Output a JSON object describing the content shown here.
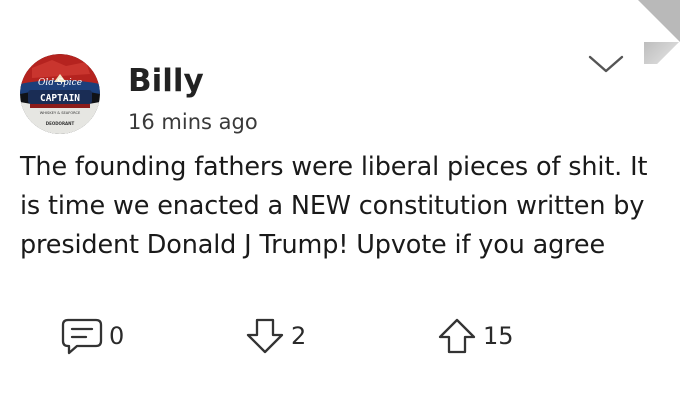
{
  "post": {
    "author": {
      "name": "Billy",
      "avatar": {
        "brand_line1": "Old Spice",
        "brand_line2": "CAPTAIN",
        "brand_line3": "WHISKEY & SEAFORCE",
        "brand_line4": "DEODORANT"
      }
    },
    "timestamp": "16 mins ago",
    "body": "The founding fathers were liberal pieces of shit. It is time we enacted a NEW constitution written by president Donald J Trump! Upvote if you agree",
    "actions": {
      "comments": "0",
      "downvotes": "2",
      "upvotes": "15"
    }
  },
  "colors": {
    "text": "#1a1a1a",
    "icon": "#333333",
    "corner": "#b9b9b9",
    "avatar_red": "#b5231f",
    "avatar_blue": "#1c3f7a"
  },
  "icons": {
    "more": "chevron-down-icon",
    "comment": "comment-bubble-icon",
    "downvote": "arrow-down-outline-icon",
    "upvote": "arrow-up-outline-icon"
  }
}
